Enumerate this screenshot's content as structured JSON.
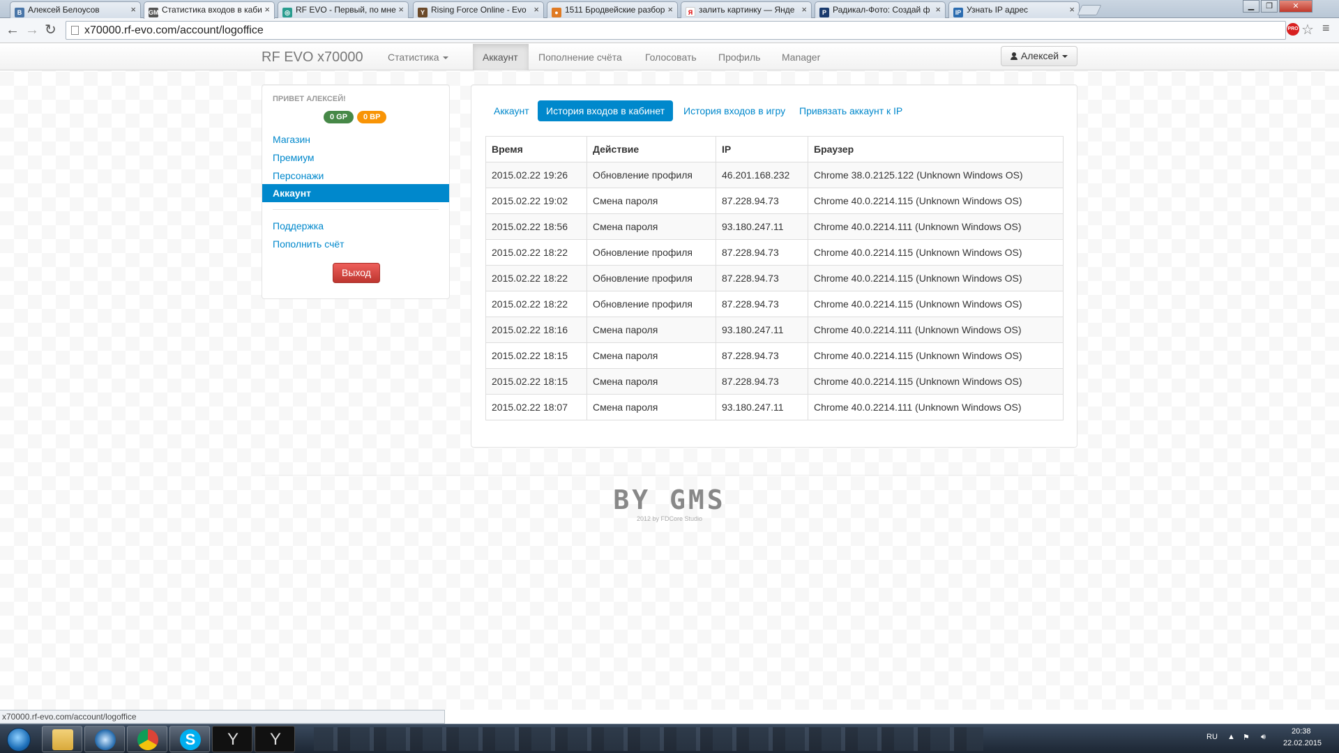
{
  "browser": {
    "tabs": [
      {
        "title": "Алексей Белоусов",
        "favicon_color": "#4a76a8",
        "favicon_text": "B"
      },
      {
        "title": "Статистика входов в каби",
        "favicon_color": "#555555",
        "favicon_text": "GMS"
      },
      {
        "title": "RF EVO - Первый, по мне",
        "favicon_color": "#2a9d8f",
        "favicon_text": "◎"
      },
      {
        "title": "Rising Force Online - Evo",
        "favicon_color": "#6b4a2a",
        "favicon_text": "Y"
      },
      {
        "title": "1511 Бродвейские разбор",
        "favicon_color": "#e07b24",
        "favicon_text": "●"
      },
      {
        "title": "залить картинку — Янде",
        "favicon_color": "#ffffff",
        "favicon_text": "Я"
      },
      {
        "title": "Радикал-Фото: Создай ф",
        "favicon_color": "#1a3b6e",
        "favicon_text": "P"
      },
      {
        "title": "Узнать IP адрес",
        "favicon_color": "#2b6cb0",
        "favicon_text": "IP"
      }
    ],
    "url": "x70000.rf-evo.com/account/logoffice",
    "status_url": "x70000.rf-evo.com/account/logoffice",
    "ext_label": "PRO"
  },
  "navbar": {
    "brand": "RF EVO x70000",
    "items": [
      "Статистика",
      "Аккаунт",
      "Пополнение счёта",
      "Голосовать",
      "Профиль",
      "Manager"
    ],
    "user": "Алексей"
  },
  "sidebar": {
    "greeting": "ПРИВЕТ АЛЕКСЕЙ!",
    "badges": [
      {
        "label": "0 GP",
        "color": "#468847"
      },
      {
        "label": "0 BP",
        "color": "#f89406"
      }
    ],
    "links": [
      "Магазин",
      "Премиум",
      "Персонажи"
    ],
    "active": "Аккаунт",
    "links2": [
      "Поддержка",
      "Пополнить счёт"
    ],
    "logout": "Выход"
  },
  "main": {
    "pills": [
      "Аккаунт",
      "История входов в кабинет",
      "История входов в игру",
      "Привязать аккаунт к IP"
    ],
    "columns": [
      "Время",
      "Действие",
      "IP",
      "Браузер"
    ],
    "rows": [
      [
        "2015.02.22 19:26",
        "Обновление профиля",
        "46.201.168.232",
        "Chrome 38.0.2125.122 (Unknown Windows OS)"
      ],
      [
        "2015.02.22 19:02",
        "Смена пароля",
        "87.228.94.73",
        "Chrome 40.0.2214.115 (Unknown Windows OS)"
      ],
      [
        "2015.02.22 18:56",
        "Смена пароля",
        "93.180.247.11",
        "Chrome 40.0.2214.111 (Unknown Windows OS)"
      ],
      [
        "2015.02.22 18:22",
        "Обновление профиля",
        "87.228.94.73",
        "Chrome 40.0.2214.115 (Unknown Windows OS)"
      ],
      [
        "2015.02.22 18:22",
        "Обновление профиля",
        "87.228.94.73",
        "Chrome 40.0.2214.115 (Unknown Windows OS)"
      ],
      [
        "2015.02.22 18:22",
        "Обновление профиля",
        "87.228.94.73",
        "Chrome 40.0.2214.115 (Unknown Windows OS)"
      ],
      [
        "2015.02.22 18:16",
        "Смена пароля",
        "93.180.247.11",
        "Chrome 40.0.2214.111 (Unknown Windows OS)"
      ],
      [
        "2015.02.22 18:15",
        "Смена пароля",
        "87.228.94.73",
        "Chrome 40.0.2214.115 (Unknown Windows OS)"
      ],
      [
        "2015.02.22 18:15",
        "Смена пароля",
        "87.228.94.73",
        "Chrome 40.0.2214.115 (Unknown Windows OS)"
      ],
      [
        "2015.02.22 18:07",
        "Смена пароля",
        "93.180.247.11",
        "Chrome 40.0.2214.111 (Unknown Windows OS)"
      ]
    ]
  },
  "footer": {
    "logo": "BY GMS",
    "sub": "2012 by FDCore Studio"
  },
  "taskbar": {
    "lang": "RU",
    "time": "20:38",
    "date": "22.02.2015"
  }
}
